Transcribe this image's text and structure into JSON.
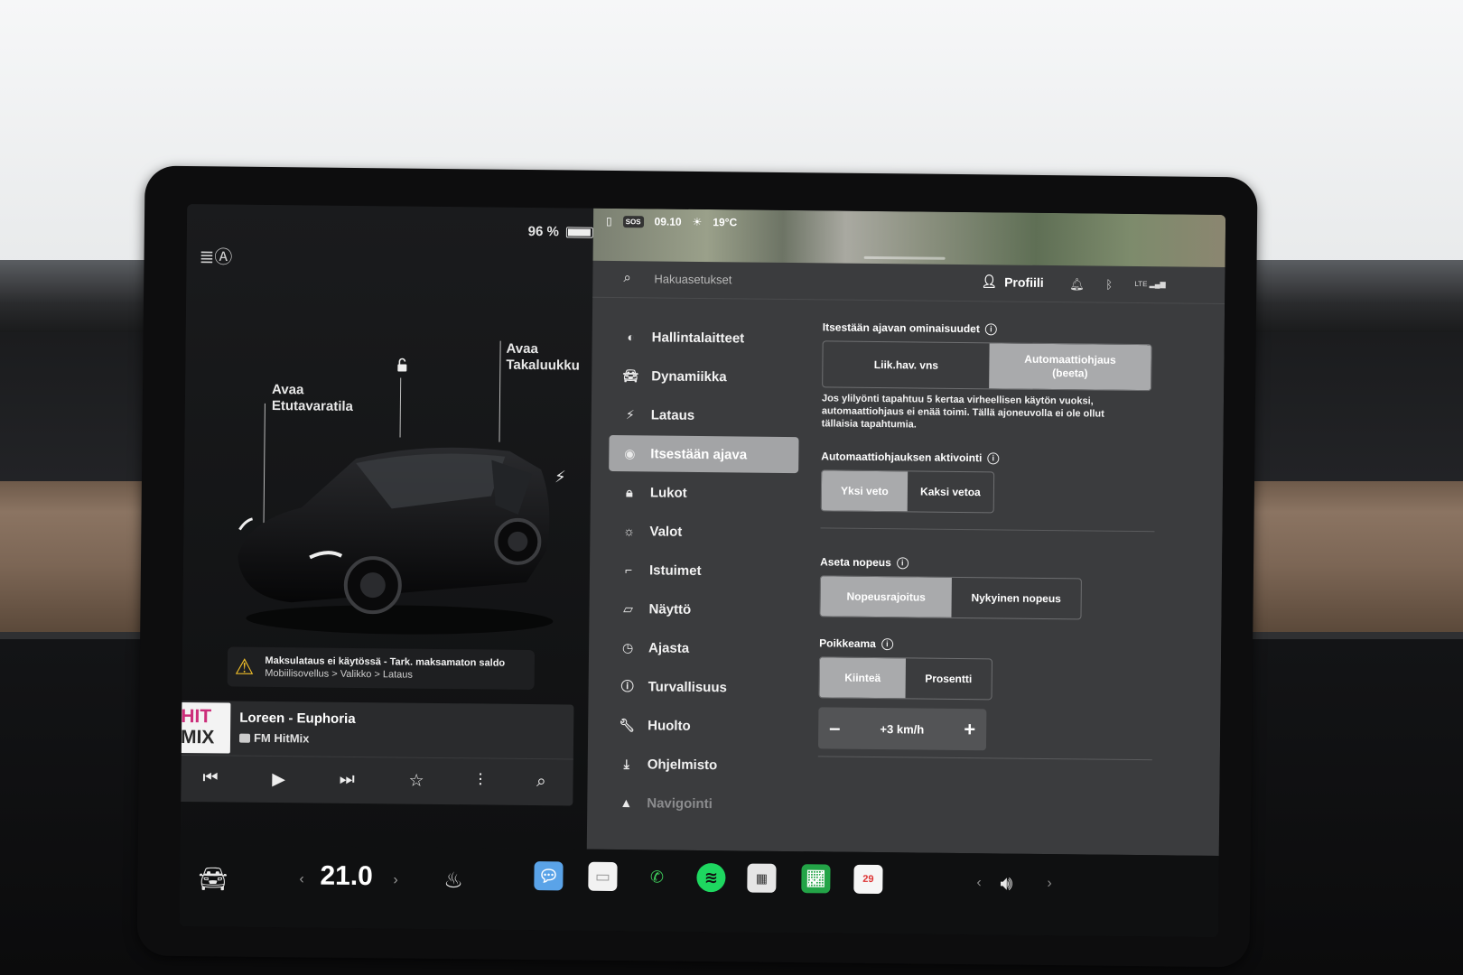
{
  "status": {
    "battery_percent": "96 %",
    "battery_level": 0.96
  },
  "car_panel": {
    "front_trunk_label_1": "Avaa",
    "front_trunk_label_2": "Etutavaratila",
    "rear_trunk_label_1": "Avaa",
    "rear_trunk_label_2": "Takaluukku"
  },
  "warning": {
    "line1": "Maksulataus ei käytössä - Tark. maksamaton saldo",
    "line2": "Mobiilisovellus > Valikko > Lataus"
  },
  "media": {
    "logo_top": "HIT",
    "logo_bottom": "MIX",
    "song": "Loreen - Euphoria",
    "station": "FM HitMix"
  },
  "map_bar": {
    "sos": "SOS",
    "time": "09.10",
    "temp": "19°C"
  },
  "topbar": {
    "search_placeholder": "Hakuasetukset",
    "profile_label": "Profiili",
    "network": "LTE"
  },
  "nav": [
    {
      "label": "Hallintalaitteet",
      "icon": "toggle-icon"
    },
    {
      "label": "Dynamiikka",
      "icon": "car-icon"
    },
    {
      "label": "Lataus",
      "icon": "bolt-icon"
    },
    {
      "label": "Itsestään ajava",
      "icon": "steering-wheel-icon",
      "active": true
    },
    {
      "label": "Lukot",
      "icon": "lock-icon"
    },
    {
      "label": "Valot",
      "icon": "sun-icon"
    },
    {
      "label": "Istuimet",
      "icon": "seat-icon"
    },
    {
      "label": "Näyttö",
      "icon": "display-icon"
    },
    {
      "label": "Ajasta",
      "icon": "clock-icon"
    },
    {
      "label": "Turvallisuus",
      "icon": "safety-icon"
    },
    {
      "label": "Huolto",
      "icon": "wrench-icon"
    },
    {
      "label": "Ohjelmisto",
      "icon": "download-icon"
    },
    {
      "label": "Navigointi",
      "icon": "navigation-icon"
    }
  ],
  "settings": {
    "features_title": "Itsestään ajavan ominaisuudet",
    "features_opt1": "Liik.hav. vns",
    "features_opt2": "Automaattiohjaus (beeta)",
    "features_desc": "Jos ylilyönti tapahtuu 5 kertaa virheellisen käytön vuoksi, automaattiohjaus ei enää toimi. Tällä ajoneuvolla ei ole ollut tällaisia tapahtumia.",
    "activation_title": "Automaattiohjauksen aktivointi",
    "activation_opt1": "Yksi veto",
    "activation_opt2": "Kaksi vetoa",
    "speed_title": "Aseta nopeus",
    "speed_opt1": "Nopeusrajoitus",
    "speed_opt2": "Nykyinen nopeus",
    "offset_title": "Poikkeama",
    "offset_opt1": "Kiinteä",
    "offset_opt2": "Prosentti",
    "offset_value": "+3 km/h"
  },
  "taskbar": {
    "temperature": "21.0",
    "calendar_day": "29"
  },
  "colors": {
    "active_nav": "#a3a4a6",
    "selected_segment": "#a9aaac",
    "warning": "#f2c02a",
    "radio_pink": "#cc2e7a"
  }
}
